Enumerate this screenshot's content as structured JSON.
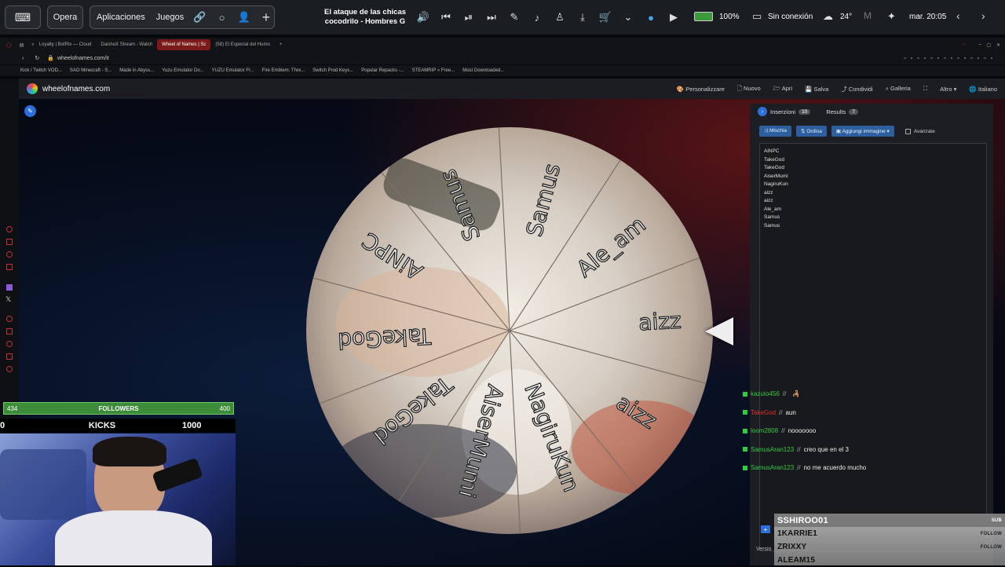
{
  "os_bar": {
    "browser_label": "Opera",
    "apps_label": "Aplicaciones",
    "games_label": "Juegos",
    "now_playing_line1": "El ataque de las chicas",
    "now_playing_line2": "cocodrilo - Hombres G",
    "battery": "100%",
    "network": "Sin conexión",
    "temperature": "24°",
    "datetime": "mar. 20:05"
  },
  "tabs": [
    "Loyalty | BotRix — Cloud",
    "DaishoX Stream - Watch",
    "Wheel of Names | Sc",
    "(58) El Especial del Humo"
  ],
  "address": "wheelofnames.com/it",
  "bookmarks": [
    "Kick / Twitch VOD...",
    "SAO Minecraft - S...",
    "Made in Abyss...",
    "Yuzu Emulator Do...",
    "YUZU Emulator Fr...",
    "Fire Emblem: Thre...",
    "Switch Prod Keys...",
    "Popular Repacks -...",
    "STEAMRIP » Free...",
    "Most Downloaded..."
  ],
  "site": {
    "logo_text": "wheelofnames.com",
    "menu": [
      "Personalizzare",
      "Nuovo",
      "Apri",
      "Salva",
      "Condividi",
      "Galleria",
      "Altro",
      "Italiano"
    ]
  },
  "wheel": {
    "segments": [
      "Samus",
      "Ale_am",
      "aizz",
      "aizz",
      "NagiruKun",
      "AiserMumi",
      "TakeGod",
      "TakeGod",
      "AiNPC",
      "Samus"
    ]
  },
  "panel": {
    "tab_entries": "Inserzioni",
    "entries_count": "10",
    "tab_results": "Results",
    "results_count": "7",
    "btn_shuffle": "Mischia",
    "btn_sort": "Ordina",
    "btn_add_image": "Aggiungi immagine",
    "advanced_label": "Avanzate",
    "entries": [
      "AiNPC",
      "TakeGod",
      "TakeGod",
      "AiserMumi",
      "NagiruKun",
      "aizz",
      "aizz",
      "Ale_am",
      "Samus",
      "Samus"
    ],
    "version_label": "Versio"
  },
  "chat": [
    {
      "user": "kazuto456",
      "message": "",
      "color": "#2ecc40"
    },
    {
      "user": "TakeGod",
      "message": "aun",
      "color": "#e03030"
    },
    {
      "user": "loom2808",
      "message": "nooooooo",
      "color": "#2ecc40"
    },
    {
      "user": "SamusAran123",
      "message": "creo que en el 3",
      "color": "#2ecc40"
    },
    {
      "user": "SamusAran123",
      "message": "no me acuerdo mucho",
      "color": "#2ecc40"
    }
  ],
  "alerts": {
    "names": [
      "SSHIROO01",
      "1KARRIE1",
      "ZRIXXY",
      "ALEAM15"
    ],
    "tags": [
      "SUB",
      "FOLLOW",
      "FOLLOW",
      ""
    ]
  },
  "overlay": {
    "followers_left": "434",
    "followers_label": "FOLLOWERS",
    "followers_right": "400",
    "followers_fraction": 1.0,
    "kicks_left": "0",
    "kicks_label": "KICKS",
    "kicks_right": "1000"
  },
  "colors": {
    "accent_blue": "#2d5f9e",
    "followers_green": "#3d8c3a",
    "chat_badge_green": "#2ecc40"
  }
}
